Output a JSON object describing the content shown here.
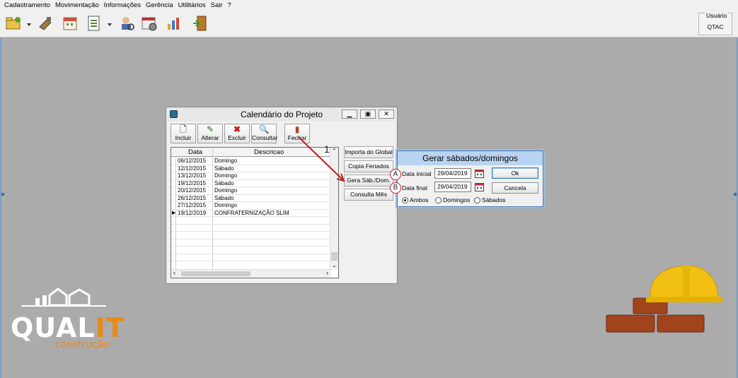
{
  "menu": [
    "Cadastramento",
    "Movimentação",
    "Informações",
    "Gerência",
    "Utilitários",
    "Sair",
    "?"
  ],
  "user": {
    "label": "Usuário",
    "value": "QTAC"
  },
  "window": {
    "title": "Calendário do Projeto",
    "toolbar": [
      {
        "label": "Incluir",
        "icon": "new-doc-icon"
      },
      {
        "label": "Alterar",
        "icon": "edit-icon"
      },
      {
        "label": "Excluir",
        "icon": "delete-x-icon"
      },
      {
        "label": "Consultar",
        "icon": "search-icon"
      },
      {
        "label": "Fechar",
        "icon": "exit-door-icon"
      }
    ],
    "grid": {
      "columns": [
        "Data",
        "Descricao"
      ],
      "rows": [
        [
          "06/12/2015",
          "Domingo"
        ],
        [
          "12/12/2015",
          "Sábado"
        ],
        [
          "13/12/2015",
          "Domingo"
        ],
        [
          "19/12/2015",
          "Sábado"
        ],
        [
          "20/12/2015",
          "Domingo"
        ],
        [
          "26/12/2015",
          "Sábado"
        ],
        [
          "27/12/2015",
          "Domingo"
        ],
        [
          "19/12/2019",
          "CONFRATERNIZAÇÃO SLIM"
        ]
      ]
    },
    "side_buttons": [
      "Importa do Global",
      "Copia Feriados",
      "Gera Sáb./Dom.",
      "Consulta Mês"
    ]
  },
  "dialog": {
    "title": "Gerar sábados/domingos",
    "start_label": "Data inicial",
    "start_value": "29/04/2019",
    "end_label": "Data final",
    "end_value": "29/04/2019",
    "ok_label": "Ok",
    "cancel_label": "Cancela",
    "radios": [
      {
        "label": "Ambos",
        "checked": true
      },
      {
        "label": "Domingos",
        "checked": false
      },
      {
        "label": "Sábados",
        "checked": false
      }
    ]
  },
  "annotations": {
    "step": "1",
    "a": "A",
    "b": "B"
  },
  "logo": {
    "main": "QUAL",
    "accent": "IT",
    "sub": "construção"
  },
  "colors": {
    "workspace": "#ababab",
    "annotation": "#c21e1e",
    "dialog_title": "#b9d4f1",
    "logo_accent": "#e88a1a"
  }
}
